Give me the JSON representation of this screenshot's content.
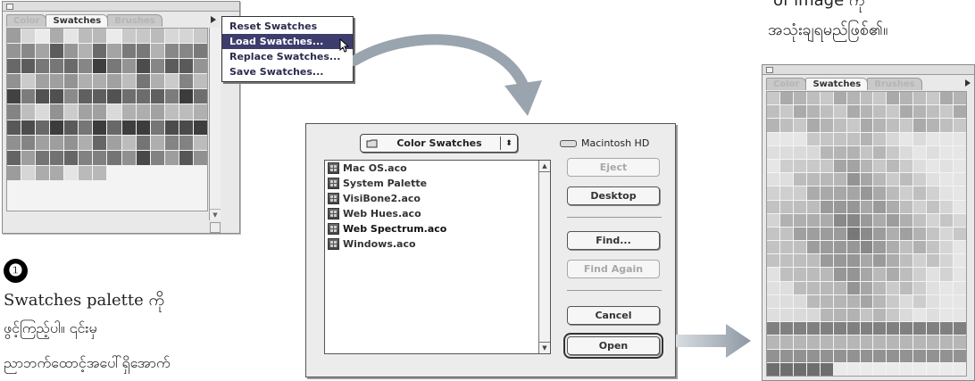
{
  "palette_left": {
    "tabs": [
      {
        "label": "Color",
        "active": false
      },
      {
        "label": "Swatches",
        "active": true
      },
      {
        "label": "Brushes",
        "active": false
      }
    ]
  },
  "flyout_menu": {
    "items": [
      {
        "label": "Reset Swatches",
        "highlighted": false
      },
      {
        "label": "Load Swatches...",
        "highlighted": true
      },
      {
        "label": "Replace Swatches...",
        "highlighted": false
      },
      {
        "label": "Save Swatches...",
        "highlighted": false
      }
    ]
  },
  "open_dialog": {
    "folder_popup": "Color Swatches",
    "volume": "Macintosh HD",
    "files": [
      {
        "name": "Mac OS.aco",
        "selected": false
      },
      {
        "name": "System Palette",
        "selected": false
      },
      {
        "name": "VisiBone2.aco",
        "selected": false
      },
      {
        "name": "Web Hues.aco",
        "selected": false
      },
      {
        "name": "Web Spectrum.aco",
        "selected": true
      },
      {
        "name": "Windows.aco",
        "selected": false
      }
    ],
    "buttons": {
      "eject": "Eject",
      "desktop": "Desktop",
      "find": "Find...",
      "find_again": "Find Again",
      "cancel": "Cancel",
      "open": "Open"
    }
  },
  "palette_right": {
    "tabs": [
      {
        "label": "Color",
        "active": false
      },
      {
        "label": "Swatches",
        "active": true
      },
      {
        "label": "Brushes",
        "active": false
      }
    ]
  },
  "step": {
    "number": "❶",
    "line1": "Swatches palette ကို",
    "line2": "ဖွင့်ကြည့်ပါ။ ၎င်းမှ",
    "line3": "ညာဘက်ထောင့်အပေါ်ရှိအောက်"
  },
  "right_caption": {
    "line1": "of image ကို",
    "line2": "အသုံးချရမည်ဖြစ်၏။"
  },
  "colors": {
    "menu_highlight": "#3d3d6d",
    "arrow_gray": "#9aa4ae"
  }
}
